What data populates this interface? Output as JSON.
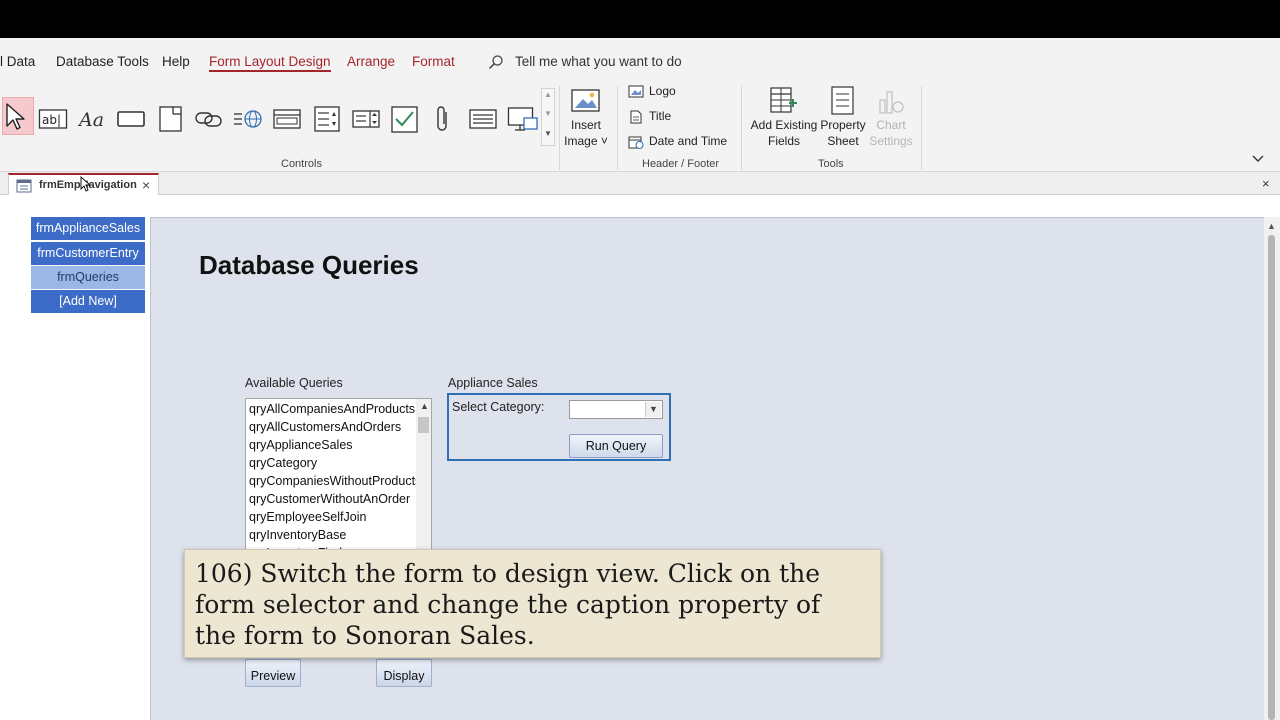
{
  "ribbon_tabs": {
    "external_data": "l Data",
    "database_tools": "Database Tools",
    "help": "Help",
    "form_layout_design": "Form Layout Design",
    "arrange": "Arrange",
    "format": "Format",
    "tell_me": "Tell me what you want to do"
  },
  "ribbon": {
    "controls_group": "Controls",
    "insert_image_line1": "Insert",
    "insert_image_line2": "Image ˅",
    "header_footer_group": "Header / Footer",
    "logo": "Logo",
    "title": "Title",
    "date_time": "Date and Time",
    "add_existing_line1": "Add Existing",
    "add_existing_line2": "Fields",
    "property_sheet_line1": "Property",
    "property_sheet_line2": "Sheet",
    "chart_settings_line1": "Chart",
    "chart_settings_line2": "Settings",
    "tools_group": "Tools",
    "textbox_glyph": "ab|",
    "label_glyph": "Aa"
  },
  "document_tab": {
    "label": "frmEmpNavigation",
    "close": "×",
    "window_close": "×"
  },
  "nav": {
    "items": [
      "frmApplianceSales",
      "frmCustomerEntry",
      "frmQueries",
      "[Add New]"
    ]
  },
  "form": {
    "title": "Database Queries",
    "available_queries_label": "Available Queries",
    "queries": [
      "qryAllCompaniesAndProducts",
      "qryAllCustomersAndOrders",
      "qryApplianceSales",
      "qryCategory",
      "qryCompaniesWithoutProducts",
      "qryCustomerWithoutAnOrder",
      "qryEmployeeSelfJoin",
      "qryInventoryBase",
      "qryInventoryFind"
    ],
    "appliance_sales_label": "Appliance Sales",
    "select_category_label": "Select Category:",
    "category_value": "",
    "run_query": "Run Query",
    "preview": "Preview",
    "display": "Display"
  },
  "caption": "106) Switch the form to design view. Click on the form selector and change the caption property of the form to Sonoran Sales.",
  "colors": {
    "accent": "#a4262c",
    "nav_blue": "#3c6cc7",
    "nav_light": "#9bb7e3",
    "form_bg": "#dde2ec",
    "group_border": "#2f6fb6",
    "caption_bg": "#ece6d2"
  }
}
